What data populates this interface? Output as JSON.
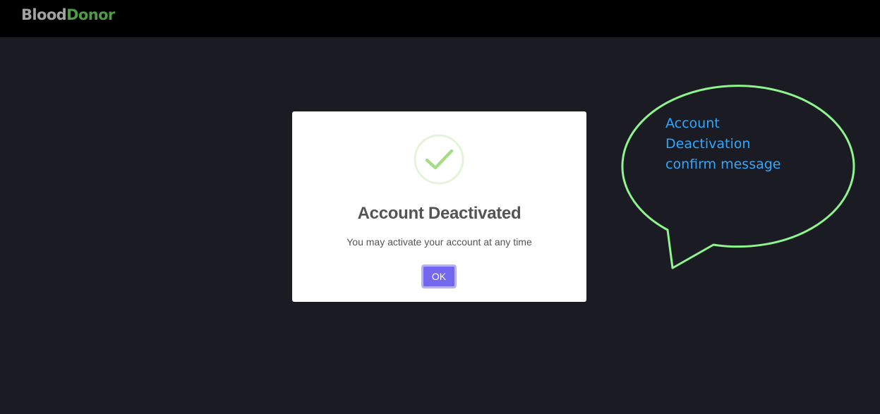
{
  "header": {
    "brand_part_a": "Blood",
    "brand_part_b": "Donor",
    "brand_colors": {
      "part_a": "#a3a3a3",
      "part_b": "#4e9a45"
    }
  },
  "dialog": {
    "icon": "checkmark-success-icon",
    "title": "Account Deactivated",
    "message": "You may activate your account at any time",
    "ok_label": "OK",
    "colors": {
      "button": "#7367f0",
      "icon": "#a5dc86"
    }
  },
  "annotation": {
    "lines": [
      "Account",
      "Deactivation",
      "confirm message"
    ],
    "colors": {
      "outline": "#8ef58e",
      "text": "#2ea7ff"
    }
  }
}
